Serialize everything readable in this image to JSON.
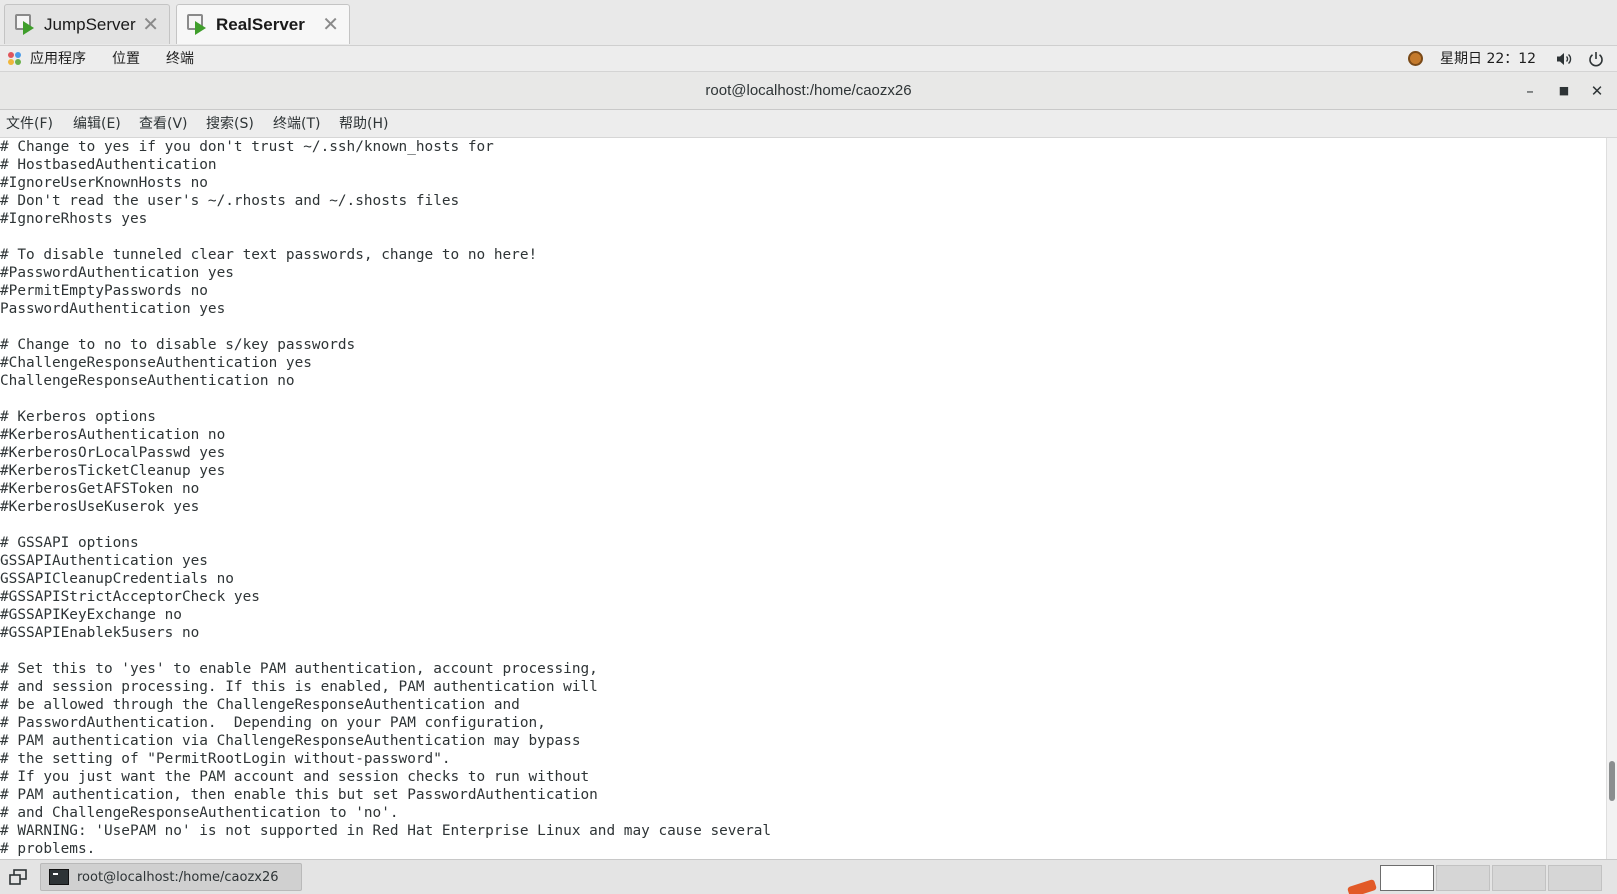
{
  "vm_tabs": [
    {
      "label": "JumpServer",
      "active": false
    },
    {
      "label": "RealServer",
      "active": true
    }
  ],
  "topbar": {
    "applications": "应用程序",
    "places": "位置",
    "terminal": "终端",
    "clock": "星期日 22：12"
  },
  "window": {
    "title": "root@localhost:/home/caozx26"
  },
  "menubar": {
    "file": "文件(F)",
    "edit": "编辑(E)",
    "view": "查看(V)",
    "search": "搜索(S)",
    "terminal": "终端(T)",
    "help": "帮助(H)"
  },
  "terminal_lines": [
    "# Change to yes if you don't trust ~/.ssh/known_hosts for",
    "# HostbasedAuthentication",
    "#IgnoreUserKnownHosts no",
    "# Don't read the user's ~/.rhosts and ~/.shosts files",
    "#IgnoreRhosts yes",
    "",
    "# To disable tunneled clear text passwords, change to no here!",
    "#PasswordAuthentication yes",
    "#PermitEmptyPasswords no",
    "PasswordAuthentication yes",
    "",
    "# Change to no to disable s/key passwords",
    "#ChallengeResponseAuthentication yes",
    "ChallengeResponseAuthentication no",
    "",
    "# Kerberos options",
    "#KerberosAuthentication no",
    "#KerberosOrLocalPasswd yes",
    "#KerberosTicketCleanup yes",
    "#KerberosGetAFSToken no",
    "#KerberosUseKuserok yes",
    "",
    "# GSSAPI options",
    "GSSAPIAuthentication yes",
    "GSSAPICleanupCredentials no",
    "#GSSAPIStrictAcceptorCheck yes",
    "#GSSAPIKeyExchange no",
    "#GSSAPIEnablek5users no",
    "",
    "# Set this to 'yes' to enable PAM authentication, account processing,",
    "# and session processing. If this is enabled, PAM authentication will",
    "# be allowed through the ChallengeResponseAuthentication and",
    "# PasswordAuthentication.  Depending on your PAM configuration,",
    "# PAM authentication via ChallengeResponseAuthentication may bypass",
    "# the setting of \"PermitRootLogin without-password\".",
    "# If you just want the PAM account and session checks to run without",
    "# PAM authentication, then enable this but set PasswordAuthentication",
    "# and ChallengeResponseAuthentication to 'no'.",
    "# WARNING: 'UsePAM no' is not supported in Red Hat Enterprise Linux and may cause several",
    "# problems."
  ],
  "taskbar": {
    "task_label": "root@localhost:/home/caozx26"
  },
  "icons": {
    "vm_tab": "vm-play-icon",
    "close": "close-icon",
    "applications": "applications-icon",
    "status": "status-icon",
    "volume": "volume-icon",
    "power": "power-icon",
    "minimize": "minimize-icon",
    "maximize": "maximize-icon",
    "show_desktop": "show-desktop-icon",
    "terminal_app": "terminal-icon"
  },
  "colors": {
    "play_green": "#3f9e2b",
    "text": "#2e3436",
    "accent_orange": "#e25a28"
  }
}
